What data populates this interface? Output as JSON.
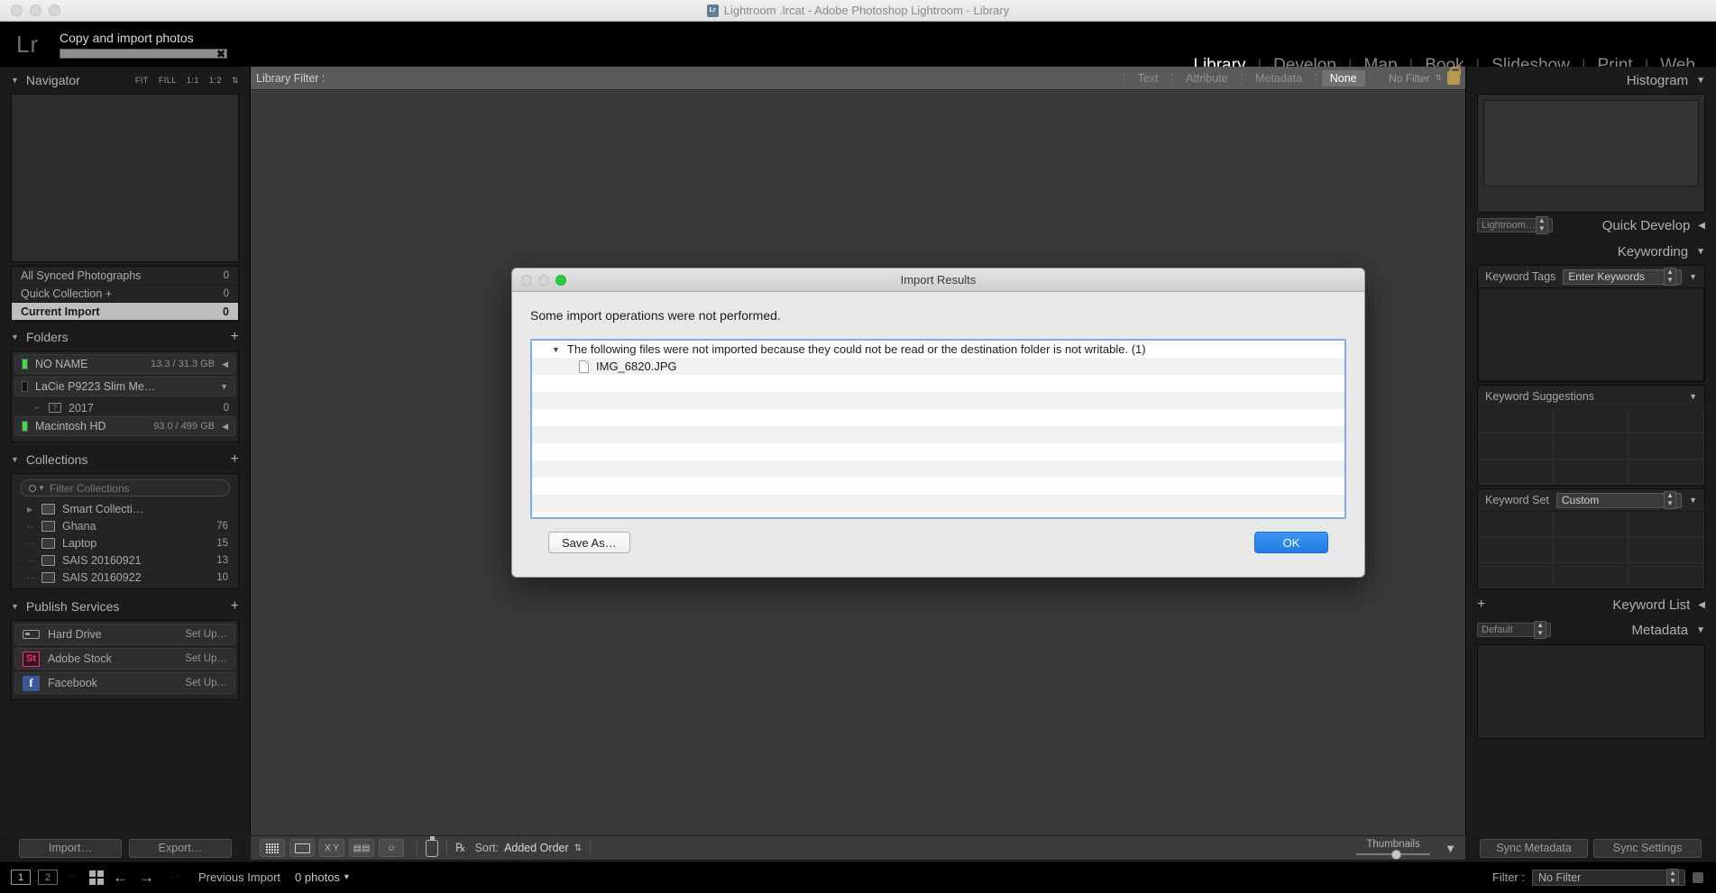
{
  "os_window": {
    "title": "Lightroom .lrcat - Adobe Photoshop Lightroom - Library",
    "doc_icon": "Lr",
    "traffic_lights": [
      "close-button",
      "minimize-button",
      "zoom-button"
    ]
  },
  "identity": {
    "logo": "Lr",
    "activity_title": "Copy and import photos",
    "progress_percent": 100,
    "cancel_glyph": "✖"
  },
  "modules": {
    "items": [
      {
        "label": "Library",
        "active": true
      },
      {
        "label": "Develop",
        "active": false
      },
      {
        "label": "Map",
        "active": false
      },
      {
        "label": "Book",
        "active": false
      },
      {
        "label": "Slideshow",
        "active": false
      },
      {
        "label": "Print",
        "active": false
      },
      {
        "label": "Web",
        "active": false
      }
    ],
    "separator": "|"
  },
  "navigator": {
    "title": "Navigator",
    "zoom_levels": [
      "FIT",
      "FILL",
      "1:1",
      "1:2"
    ],
    "stepper_glyph": "⇅"
  },
  "catalog": {
    "rows": [
      {
        "name": "All Synced Photographs",
        "count": "0",
        "selected": false
      },
      {
        "name": "Quick Collection  +",
        "count": "0",
        "selected": false
      },
      {
        "name": "Current Import",
        "count": "0",
        "selected": true
      }
    ]
  },
  "folders": {
    "title": "Folders",
    "add_glyph": "+",
    "volumes": [
      {
        "name": "NO NAME",
        "size": "13.3 / 31.3 GB",
        "led": "on",
        "arrow": "◀",
        "children": []
      },
      {
        "name": "LaCie P9223 Slim Me…",
        "size": "",
        "led": "off",
        "arrow": "▼",
        "children": [
          {
            "name": "2017",
            "count": "0",
            "badge": "?"
          }
        ]
      },
      {
        "name": "Macintosh HD",
        "size": "93.0 / 499 GB",
        "led": "on",
        "arrow": "◀",
        "children": []
      }
    ]
  },
  "collections": {
    "title": "Collections",
    "add_glyph": "+",
    "filter_placeholder": "Filter Collections",
    "search_glyph": "Q",
    "items": [
      {
        "name": "Smart Collecti…",
        "count": "",
        "kind": "smart",
        "disclosure": "▶"
      },
      {
        "name": "Ghana",
        "count": "76",
        "kind": "collection",
        "disclosure": "⋯"
      },
      {
        "name": "Laptop",
        "count": "15",
        "kind": "collection",
        "disclosure": "⋯"
      },
      {
        "name": "SAIS 20160921",
        "count": "13",
        "kind": "collection",
        "disclosure": "⋯"
      },
      {
        "name": "SAIS 20160922",
        "count": "10",
        "kind": "collection",
        "disclosure": "⋯"
      }
    ]
  },
  "publish_services": {
    "title": "Publish Services",
    "add_glyph": "+",
    "items": [
      {
        "name": "Hard Drive",
        "action": "Set Up…",
        "icon": "hard-drive-icon"
      },
      {
        "name": "Adobe Stock",
        "action": "Set Up…",
        "icon": "adobe-stock-icon",
        "icon_text": "St",
        "color": "#ff2b7a"
      },
      {
        "name": "Facebook",
        "action": "Set Up…",
        "icon": "facebook-icon",
        "icon_text": "f",
        "color": "#3b5998"
      }
    ]
  },
  "left_buttons": {
    "import": "Import…",
    "export": "Export…"
  },
  "library_filter": {
    "title": "Library Filter :",
    "tabs": [
      {
        "label": "Text",
        "active": false
      },
      {
        "label": "Attribute",
        "active": false
      },
      {
        "label": "Metadata",
        "active": false
      },
      {
        "label": "None",
        "active": true
      }
    ],
    "preset": "No Filter",
    "stepper_glyph": "⇅",
    "lock_icon": "lock-icon"
  },
  "right_panels": {
    "histogram": {
      "title": "Histogram",
      "collapse_glyph": "▼"
    },
    "quick_develop": {
      "title": "Quick Develop",
      "preset": "Lightroom…",
      "collapse_glyph": "◀"
    },
    "keywording": {
      "title": "Keywording",
      "collapse_glyph": "▼",
      "keyword_tags_label": "Keyword Tags",
      "keyword_tags_value": "Enter Keywords",
      "suggestions_label": "Keyword Suggestions",
      "keyword_set_label": "Keyword Set",
      "keyword_set_value": "Custom"
    },
    "keyword_list": {
      "title": "Keyword List",
      "add_glyph": "+",
      "collapse_glyph": "◀"
    },
    "metadata": {
      "title": "Metadata",
      "preset": "Default",
      "collapse_glyph": "▼"
    }
  },
  "toolbar": {
    "view_modes": [
      "grid-view-icon",
      "loupe-view-icon",
      "compare-view-icon",
      "survey-view-icon",
      "people-view-icon"
    ],
    "painter_icon": "spray-can-icon",
    "sort_icon": "sort-az-icon",
    "sort_label": "Sort:",
    "sort_value": "Added Order",
    "sort_stepper": "⇅",
    "thumbnails_label": "Thumbnails",
    "thumbnail_size_percent": 48,
    "popup_glyph": "▼",
    "sync_metadata": "Sync Metadata",
    "sync_settings": "Sync Settings"
  },
  "filmstrip": {
    "screen_one": "1",
    "screen_two": "2",
    "grid_icon": "grid-icon",
    "back_arrow": "←",
    "forward_arrow": "→",
    "source_label": "Previous Import",
    "photo_count": "0 photos",
    "count_caret": "▾",
    "filter_label": "Filter :",
    "filter_value": "No Filter",
    "filter_stepper": "⇅"
  },
  "dialog": {
    "title": "Import Results",
    "traffic_lights": [
      "close-button",
      "minimize-button",
      "zoom-button"
    ],
    "message": "Some import operations were not performed.",
    "list": {
      "group_disclosure": "▼",
      "group_text": "The following files were not imported because they could not be read or the destination folder is not writable. (1)",
      "files": [
        "IMG_6820.JPG"
      ],
      "empty_rows": 8
    },
    "buttons": {
      "save_as": "Save As…",
      "ok": "OK"
    },
    "accent_color": "#2f86e8",
    "focus_ring_color": "#7aaee8"
  }
}
